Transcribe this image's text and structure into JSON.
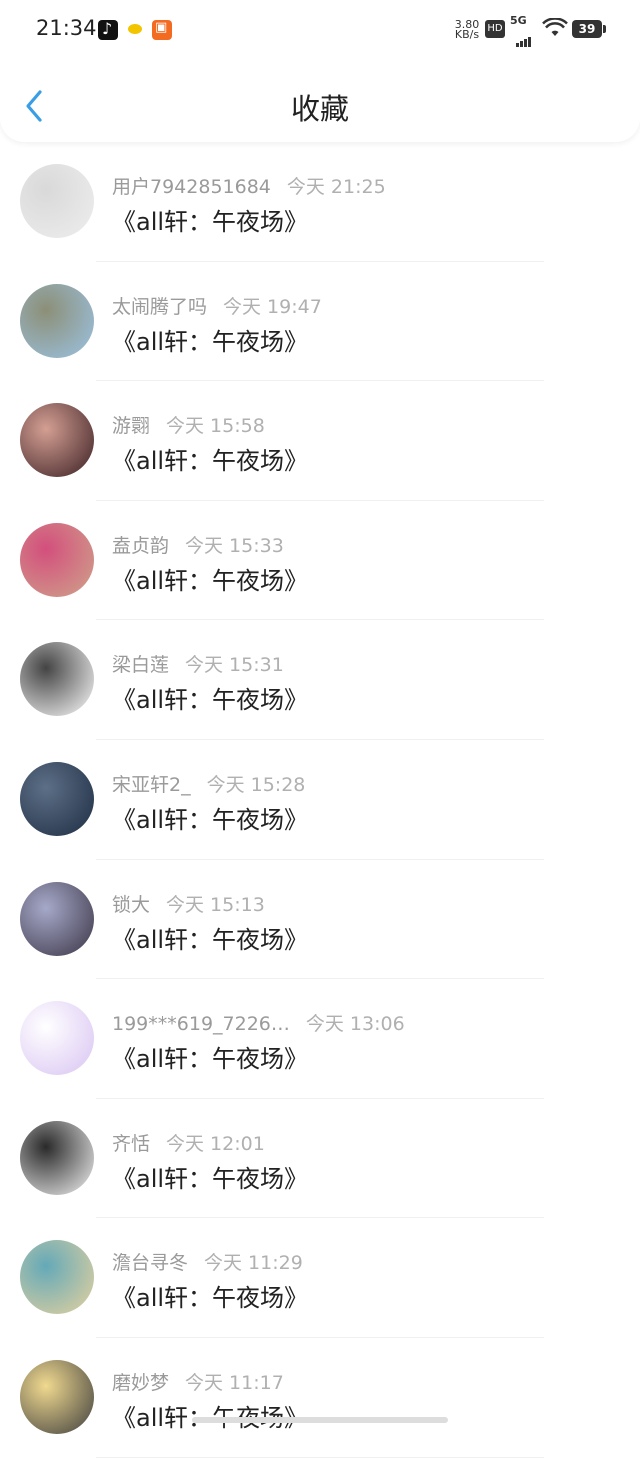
{
  "status_bar": {
    "time": "21:34",
    "net_speed_value": "3.80",
    "net_speed_unit": "KB/s",
    "hd": "HD",
    "network": "5G",
    "battery": "39"
  },
  "header": {
    "title": "收藏"
  },
  "favorites": [
    {
      "username": "用户7942851684",
      "time": "今天 21:25",
      "title": "《all轩：午夜场》",
      "avatar_colors": [
        "#eeeeee",
        "#d9d9d9"
      ]
    },
    {
      "username": "太闹腾了吗",
      "time": "今天 19:47",
      "title": "《all轩：午夜场》",
      "avatar_colors": [
        "#9cc3e4",
        "#8c8f77"
      ]
    },
    {
      "username": "游翾",
      "time": "今天 15:58",
      "title": "《all轩：午夜场》",
      "avatar_colors": [
        "#3a1f23",
        "#d49f93"
      ]
    },
    {
      "username": "盍贞韵",
      "time": "今天 15:33",
      "title": "《all轩：午夜场》",
      "avatar_colors": [
        "#cfa48a",
        "#d34f7d"
      ]
    },
    {
      "username": "梁白莲",
      "time": "今天 15:31",
      "title": "《all轩：午夜场》",
      "avatar_colors": [
        "#ffffff",
        "#444444"
      ]
    },
    {
      "username": "宋亚轩2_",
      "time": "今天 15:28",
      "title": "《all轩：午夜场》",
      "avatar_colors": [
        "#1d2d44",
        "#5d6f86"
      ]
    },
    {
      "username": "锁大",
      "time": "今天 15:13",
      "title": "《all轩：午夜场》",
      "avatar_colors": [
        "#3a3445",
        "#a6a9c9"
      ]
    },
    {
      "username": "199***619_7226…",
      "time": "今天 13:06",
      "title": "《all轩：午夜场》",
      "avatar_colors": [
        "#d8c3f2",
        "#ffffff"
      ]
    },
    {
      "username": "齐恬",
      "time": "今天 12:01",
      "title": "《all轩：午夜场》",
      "avatar_colors": [
        "#f5f5f5",
        "#2a2a2a"
      ]
    },
    {
      "username": "澹台寻冬",
      "time": "今天 11:29",
      "title": "《all轩：午夜场》",
      "avatar_colors": [
        "#e7d29e",
        "#64a9b8"
      ]
    },
    {
      "username": "磨妙梦",
      "time": "今天 11:17",
      "title": "《all轩：午夜场》",
      "avatar_colors": [
        "#3d3d3d",
        "#f0d98f"
      ]
    }
  ]
}
